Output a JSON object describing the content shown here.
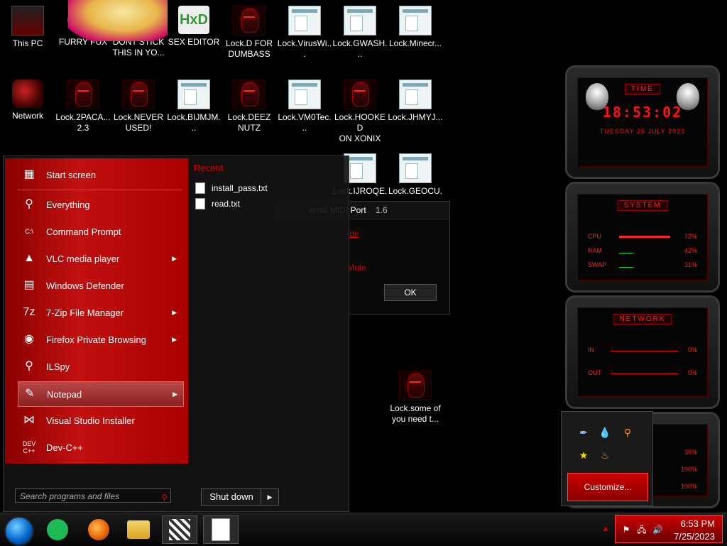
{
  "desktop": {
    "icons": [
      {
        "label": "This PC",
        "kind": "pc"
      },
      {
        "label": "FURRY FUX",
        "kind": "fox"
      },
      {
        "label": "DONT STICK\nTHIS IN YO...",
        "kind": "cartoon"
      },
      {
        "label": "SEX EDITOR",
        "kind": "hxd",
        "glyph": "HxD"
      },
      {
        "label": "Lock.D FOR\nDUMBASS",
        "kind": "lock"
      },
      {
        "label": "Lock.VirusWi...",
        "kind": "txt"
      },
      {
        "label": "Lock.GWASH...",
        "kind": "txt"
      },
      {
        "label": "Lock.Minecr...",
        "kind": "txt"
      },
      {
        "label": "Network",
        "kind": "net"
      },
      {
        "label": "Lock.2PACA...\n2.3",
        "kind": "lock"
      },
      {
        "label": "Lock.NEVER\nUSED!",
        "kind": "lock"
      },
      {
        "label": "Lock.BIJMJM...",
        "kind": "txt"
      },
      {
        "label": "Lock.DEEZ\nNUTZ",
        "kind": "lock"
      },
      {
        "label": "Lock.VM0Tec...",
        "kind": "txt"
      },
      {
        "label": "Lock.HOOKED\nON XONIX",
        "kind": "lock"
      },
      {
        "label": "Lock.JHMYJ...",
        "kind": "txt"
      },
      {
        "label": "Lock.IJROQE...",
        "kind": "txt"
      },
      {
        "label": "Lock.GEOCU...",
        "kind": "txt"
      },
      {
        "label": "Lock.some of\nyou need t...",
        "kind": "lock"
      }
    ]
  },
  "background_window": {
    "title_part": "ernal MIDI Port",
    "version": "1.6",
    "link": ".de",
    "mute": "Mute",
    "ok": "OK"
  },
  "start_menu": {
    "items": [
      {
        "label": "Start screen",
        "icon": "start-screen-icon",
        "glyph": "▦",
        "arrow": false
      },
      {
        "label": "Everything",
        "icon": "magnifier-icon",
        "glyph": "⚲",
        "arrow": false
      },
      {
        "label": "Command Prompt",
        "icon": "terminal-icon",
        "glyph": "C:\\",
        "arrow": false
      },
      {
        "label": "VLC media player",
        "icon": "vlc-cone-icon",
        "glyph": "▲",
        "arrow": true
      },
      {
        "label": "Windows Defender",
        "icon": "brick-wall-icon",
        "glyph": "▤",
        "arrow": false
      },
      {
        "label": "7-Zip File Manager",
        "icon": "seven-zip-icon",
        "glyph": "7z",
        "arrow": true
      },
      {
        "label": "Firefox Private Browsing",
        "icon": "firefox-private-icon",
        "glyph": "◉",
        "arrow": true
      },
      {
        "label": "ILSpy",
        "icon": "ilspy-icon",
        "glyph": "⚲",
        "arrow": false
      },
      {
        "label": "Notepad",
        "icon": "notepad-icon",
        "glyph": "✎",
        "arrow": true
      },
      {
        "label": "Visual Studio Installer",
        "icon": "visual-studio-icon",
        "glyph": "⋈",
        "arrow": false
      },
      {
        "label": "Dev-C++",
        "icon": "devcpp-icon",
        "glyph": "DEV\nC++",
        "arrow": false
      }
    ],
    "recent_header": "Recent",
    "recent": [
      "install_pass.txt",
      "read.txt"
    ],
    "search_placeholder": "Search programs and files",
    "shutdown": "Shut down",
    "arrow": "▶"
  },
  "gadgets": {
    "time": {
      "title": "TIME",
      "clock": "18:53:02",
      "date": "TUESDAY 25 JULY 2023"
    },
    "system": {
      "title": "SYSTEM",
      "rows": [
        {
          "key": "CPU",
          "value": "72%",
          "level": 0.72
        },
        {
          "key": "RAM",
          "value": "42%",
          "level": 0.42
        },
        {
          "key": "SWAP",
          "value": "31%",
          "level": 0.31
        }
      ]
    },
    "network": {
      "title": "NETWORK",
      "rows": [
        {
          "key": "IN",
          "value": "0%"
        },
        {
          "key": "OUT",
          "value": "0%"
        }
      ]
    },
    "drives": {
      "values": [
        "36%",
        "100%",
        "100%"
      ]
    }
  },
  "tray_popup": {
    "customize": "Customize..."
  },
  "taskbar": {
    "time": "6:53 PM",
    "date": "7/25/2023"
  },
  "colors": {
    "accent": "#cc0000",
    "menu_red": "#b01010"
  }
}
